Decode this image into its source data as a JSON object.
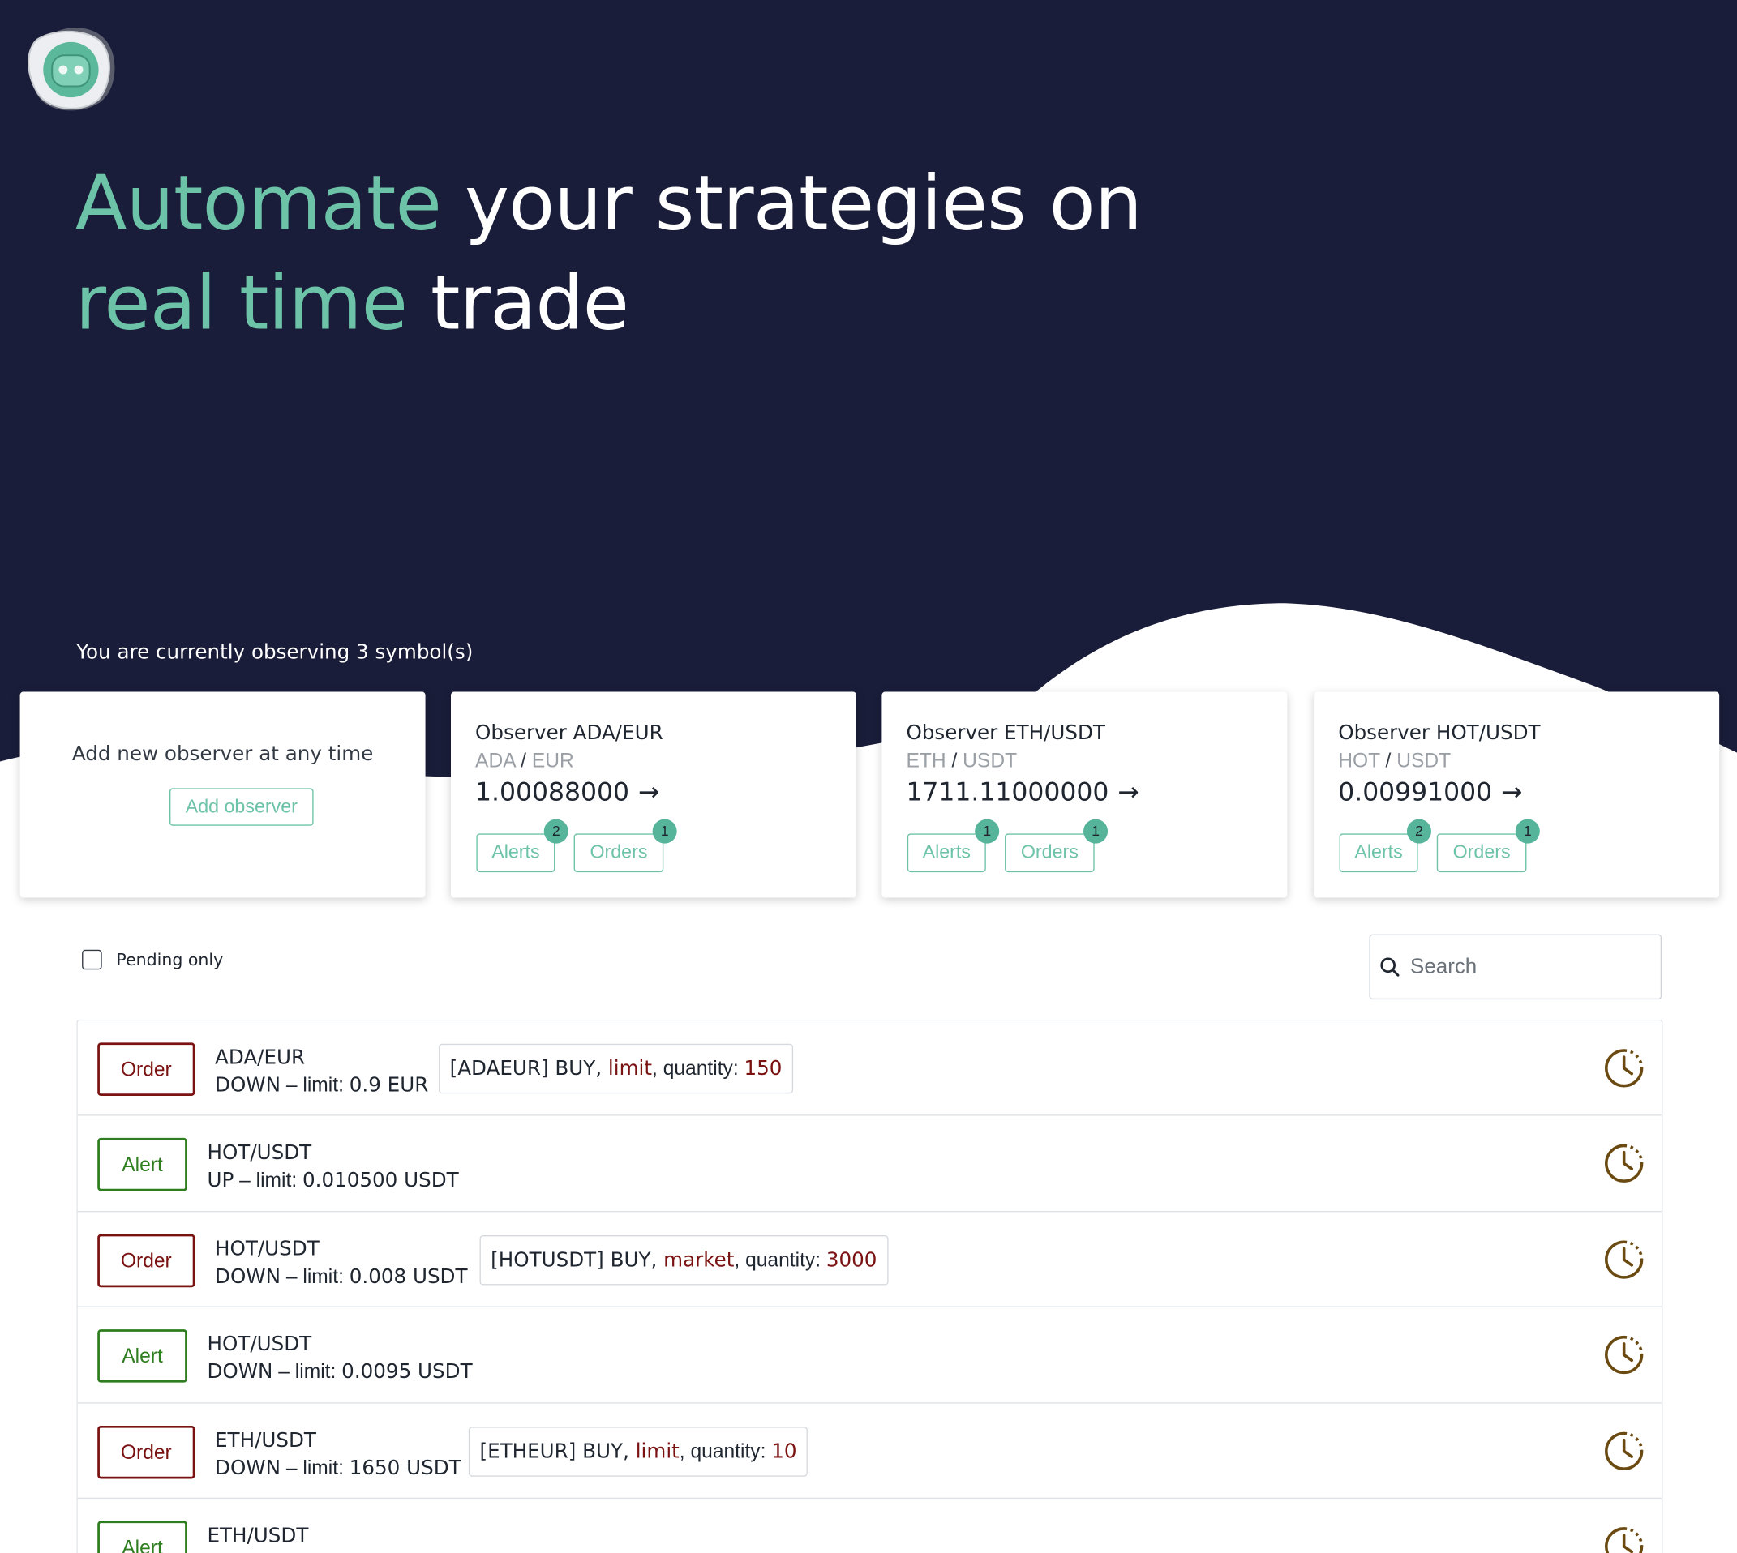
{
  "headline": {
    "accent_1": "Automate",
    "rest_1": " your strategies on",
    "accent_2": "real time",
    "rest_2": " trade"
  },
  "observing_text": "You are currently observing 3 symbol(s)",
  "add_card": {
    "text": "Add new observer at any time",
    "button_label": "Add observer"
  },
  "observers": [
    {
      "title": "Observer ADA/EUR",
      "base": "ADA",
      "sep": "/",
      "quote": "EUR",
      "price": "1.00088000",
      "arrow": "→",
      "alerts_label": "Alerts",
      "alerts_count": "2",
      "orders_label": "Orders",
      "orders_count": "1"
    },
    {
      "title": "Observer ETH/USDT",
      "base": "ETH",
      "sep": "/",
      "quote": "USDT",
      "price": "1711.11000000",
      "arrow": "→",
      "alerts_label": "Alerts",
      "alerts_count": "1",
      "orders_label": "Orders",
      "orders_count": "1"
    },
    {
      "title": "Observer HOT/USDT",
      "base": "HOT",
      "sep": "/",
      "quote": "USDT",
      "price": "0.00991000",
      "arrow": "→",
      "alerts_label": "Alerts",
      "alerts_count": "2",
      "orders_label": "Orders",
      "orders_count": "1"
    }
  ],
  "filters": {
    "pending_label": "Pending only",
    "search_placeholder": "Search"
  },
  "rows": [
    {
      "type": "Order",
      "symbol": "ADA/EUR",
      "direction": "DOWN",
      "limit_label": " – limit: ",
      "limit": "0.9 EUR",
      "order": {
        "prefix": "[ADAEUR] BUY, ",
        "kind": "limit",
        "qty_label": ", quantity: ",
        "qty": "150"
      }
    },
    {
      "type": "Alert",
      "symbol": "HOT/USDT",
      "direction": "UP",
      "limit_label": " – limit: ",
      "limit": "0.010500 USDT"
    },
    {
      "type": "Order",
      "symbol": "HOT/USDT",
      "direction": "DOWN",
      "limit_label": " – limit: ",
      "limit": "0.008 USDT",
      "order": {
        "prefix": "[HOTUSDT] BUY, ",
        "kind": "market",
        "qty_label": ", quantity: ",
        "qty": "3000"
      }
    },
    {
      "type": "Alert",
      "symbol": "HOT/USDT",
      "direction": "DOWN",
      "limit_label": " – limit: ",
      "limit": "0.0095 USDT"
    },
    {
      "type": "Order",
      "symbol": "ETH/USDT",
      "direction": "DOWN",
      "limit_label": " – limit: ",
      "limit": "1650 USDT",
      "order": {
        "prefix": "[ETHEUR] BUY, ",
        "kind": "limit",
        "qty_label": ", quantity: ",
        "qty": "10"
      }
    },
    {
      "type": "Alert",
      "symbol": "ETH/USDT"
    }
  ],
  "icons": {
    "logo": "robot-logo-icon",
    "search": "search-icon",
    "row_status": "pending-clock-icon"
  },
  "colors": {
    "hero_bg": "#1a1d39",
    "accent": "#6cc3a8",
    "order": "#7a1212",
    "alert": "#2e7d1f",
    "clock": "#6b4a12"
  }
}
